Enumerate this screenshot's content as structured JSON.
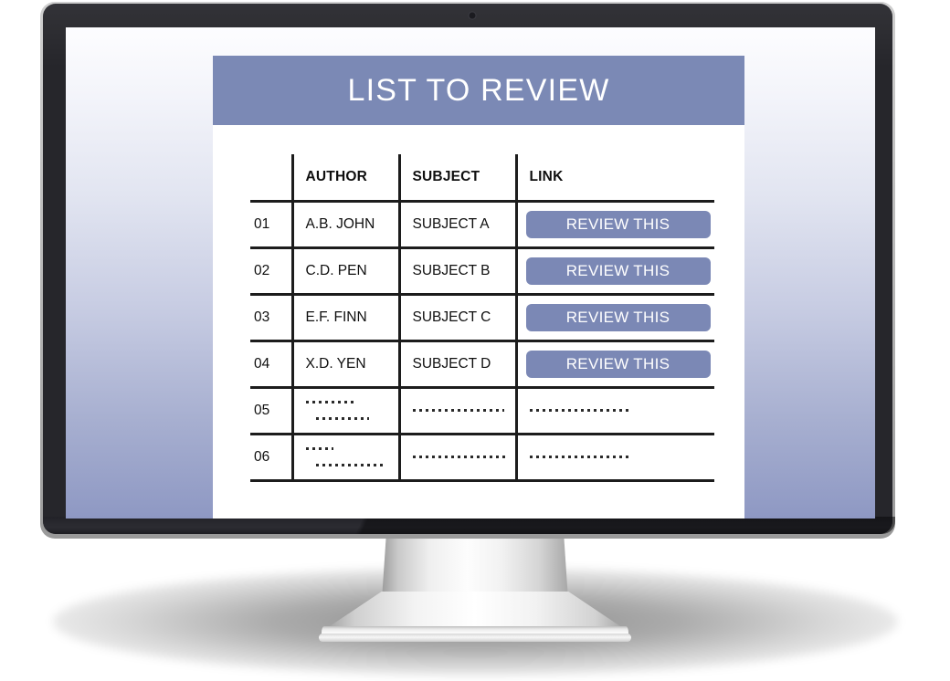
{
  "device": {
    "type": "desktop-monitor",
    "webcam": "webcam-dot"
  },
  "screen": {
    "background_gradient_from": "#fdfdff",
    "background_gradient_to": "#8e98c3"
  },
  "card": {
    "title": "LIST TO REVIEW",
    "header_color": "#7b89b5",
    "background": "#ffffff"
  },
  "table": {
    "columns": [
      "",
      "AUTHOR",
      "SUBJECT",
      "LINK"
    ],
    "headers": {
      "num": "",
      "author": "AUTHOR",
      "subject": "SUBJECT",
      "link": "LINK"
    },
    "button_label": "REVIEW THIS",
    "button_color": "#7b88b5",
    "rows": [
      {
        "num": "01",
        "author": "A.B. JOHN",
        "subject": "SUBJECT A",
        "link_label": "REVIEW THIS",
        "has_button": true
      },
      {
        "num": "02",
        "author": "C.D. PEN",
        "subject": "SUBJECT B",
        "link_label": "REVIEW THIS",
        "has_button": true
      },
      {
        "num": "03",
        "author": "E.F. FINN",
        "subject": "SUBJECT C",
        "link_label": "REVIEW THIS",
        "has_button": true
      },
      {
        "num": "04",
        "author": "X.D. YEN",
        "subject": "SUBJECT D",
        "link_label": "REVIEW THIS",
        "has_button": true
      },
      {
        "num": "05",
        "author": "",
        "subject": "",
        "link_label": "",
        "has_button": false
      },
      {
        "num": "06",
        "author": "",
        "subject": "",
        "link_label": "",
        "has_button": false
      }
    ]
  }
}
